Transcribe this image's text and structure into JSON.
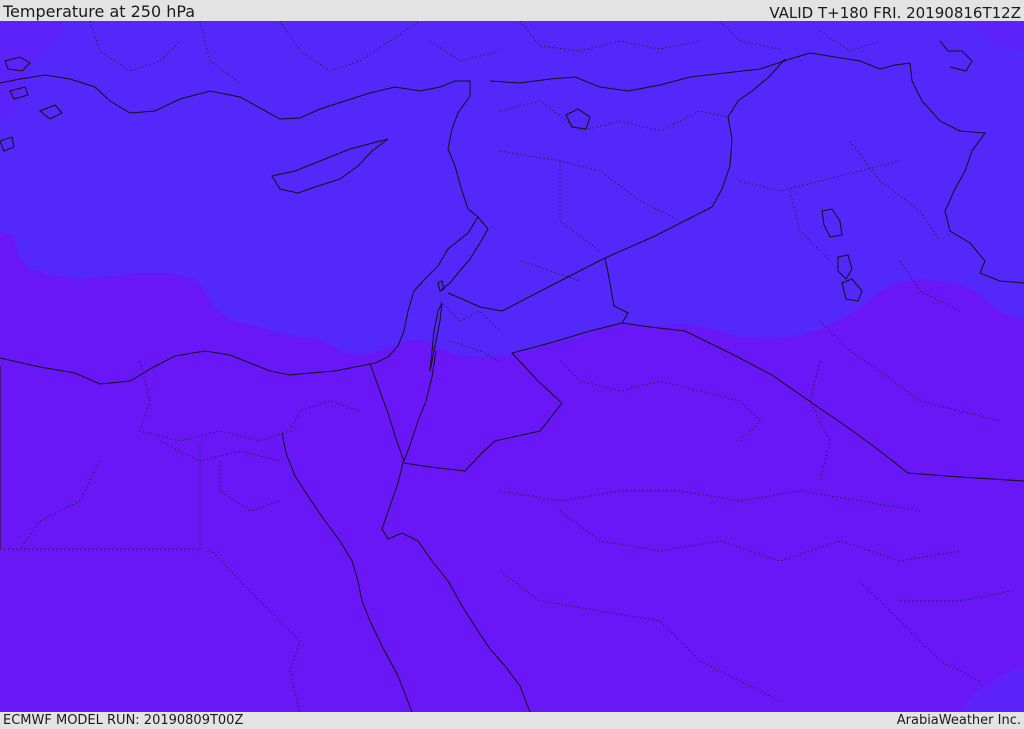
{
  "header": {
    "title": "Temperature at 250 hPa",
    "valid_time": "VALID T+180 FRI. 20190816T12Z"
  },
  "footer": {
    "model_run": "ECMWF MODEL RUN: 20190809T00Z",
    "credit": "ArabiaWeather Inc."
  },
  "map": {
    "field": "temperature",
    "level": "250 hPa",
    "colors": {
      "warm_band": "#6a17f8",
      "cool_band": "#5428fa",
      "edge_band": "#5d21fa",
      "coastline": "#111111",
      "border": "#111111",
      "province_line": "#222222"
    }
  }
}
